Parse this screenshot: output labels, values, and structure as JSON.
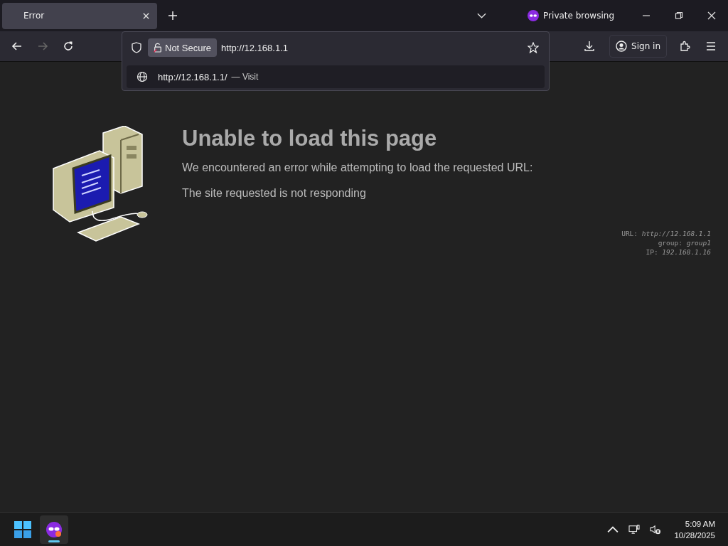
{
  "tabs": [
    {
      "title": "Error",
      "selected": true
    }
  ],
  "private_label": "Private browsing",
  "toolbar": {
    "forward_disabled": true,
    "security_label": "Not Secure",
    "url": "http://12.168.1.1",
    "sign_in": "Sign in"
  },
  "suggestions": [
    {
      "url": "http://12.168.1.1/",
      "action": "— Visit"
    }
  ],
  "error": {
    "title": "Unable to load this page",
    "message": "We encountered an error while attempting to load the requested URL:",
    "reason": "The site requested is not responding"
  },
  "details": [
    "URL: *http://12.168.1.1*",
    "group: *group1*",
    "IP: *192.168.1.16*"
  ],
  "taskbar": {
    "apps": [
      {
        "running": true
      }
    ],
    "time": "5:09 AM",
    "date": "10/28/2025"
  }
}
